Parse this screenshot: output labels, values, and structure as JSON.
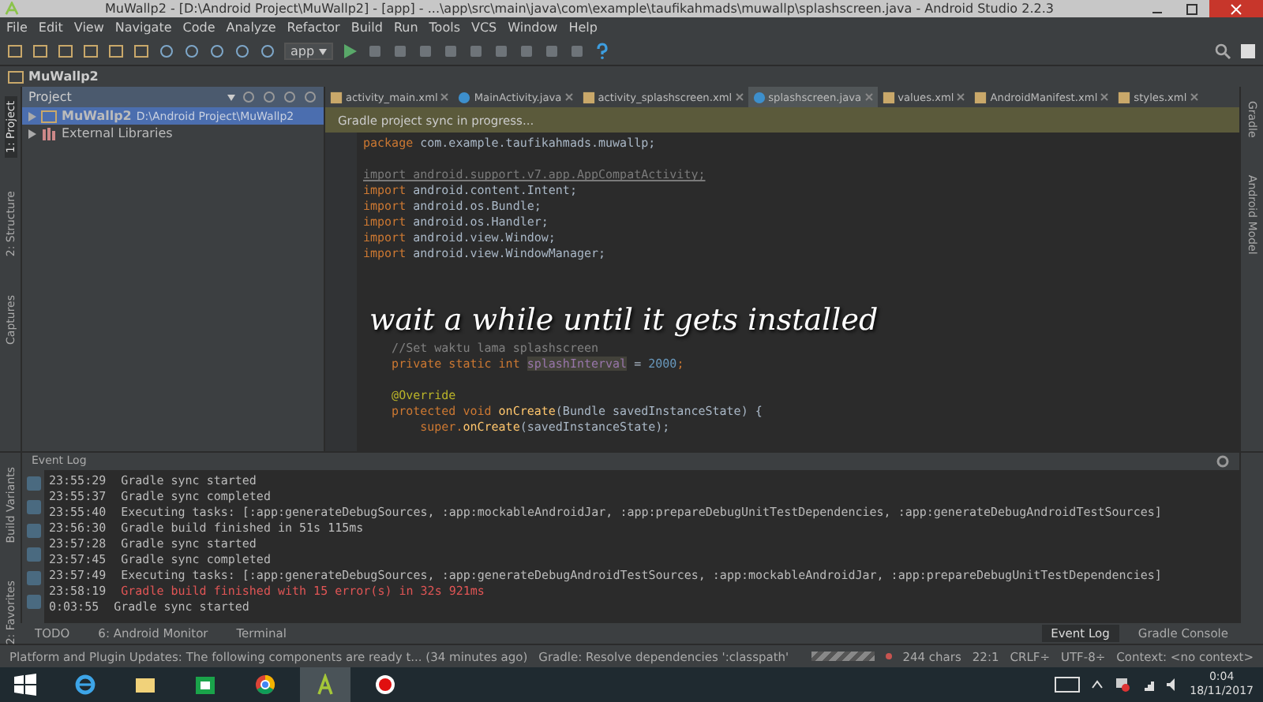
{
  "window": {
    "title": "MuWallp2 - [D:\\Android Project\\MuWallp2] - [app] - ...\\app\\src\\main\\java\\com\\example\\taufikahmads\\muwallp\\splashscreen.java - Android Studio 2.2.3"
  },
  "menu": [
    "File",
    "Edit",
    "View",
    "Navigate",
    "Code",
    "Analyze",
    "Refactor",
    "Build",
    "Run",
    "Tools",
    "VCS",
    "Window",
    "Help"
  ],
  "toolbar": {
    "run_config": "app"
  },
  "breadcrumb": "MuWallp2",
  "left_stripe": [
    {
      "label": "1: Project",
      "selected": true
    },
    {
      "label": "2: Structure",
      "selected": false
    },
    {
      "label": "Captures",
      "selected": false
    }
  ],
  "project_panel": {
    "view": "Project",
    "tree": [
      {
        "label": "MuWallp2",
        "path": "D:\\Android Project\\MuWallp2",
        "kind": "module",
        "selected": true
      },
      {
        "label": "External Libraries",
        "kind": "library",
        "selected": false
      }
    ]
  },
  "editor_tabs": [
    {
      "label": "activity_main.xml",
      "kind": "xml",
      "selected": false
    },
    {
      "label": "MainActivity.java",
      "kind": "class",
      "selected": false
    },
    {
      "label": "activity_splashscreen.xml",
      "kind": "xml",
      "selected": false
    },
    {
      "label": "splashscreen.java",
      "kind": "class",
      "selected": true
    },
    {
      "label": "values.xml",
      "kind": "xml",
      "selected": false
    },
    {
      "label": "AndroidManifest.xml",
      "kind": "xml",
      "selected": false
    },
    {
      "label": "styles.xml",
      "kind": "xml",
      "selected": false
    }
  ],
  "notification": "Gradle project sync in progress...",
  "code_blocks": [
    {
      "lines": [
        [
          {
            "text": "package ",
            "kind": "keyword"
          },
          {
            "text": "com.example.taufikahmads.muwallp;",
            "kind": "plain"
          }
        ]
      ]
    },
    {
      "lines": [
        [
          {
            "text": "import android.support.v7.app.AppCompatActivity;",
            "kind": "unused"
          }
        ],
        [
          {
            "text": "import ",
            "kind": "keyword"
          },
          {
            "text": "android.content.Intent;",
            "kind": "plain"
          }
        ],
        [
          {
            "text": "import ",
            "kind": "keyword"
          },
          {
            "text": "android.os.Bundle;",
            "kind": "plain"
          }
        ],
        [
          {
            "text": "import ",
            "kind": "keyword"
          },
          {
            "text": "android.os.Handler;",
            "kind": "plain"
          }
        ],
        [
          {
            "text": "import ",
            "kind": "keyword"
          },
          {
            "text": "android.view.Window;",
            "kind": "plain"
          }
        ],
        [
          {
            "text": "import ",
            "kind": "keyword"
          },
          {
            "text": "android.view.WindowManager;",
            "kind": "plain"
          }
        ]
      ]
    },
    {
      "lines": [
        [
          {
            "text": "    //Set waktu lama splashscreen",
            "kind": "comment"
          }
        ],
        [
          {
            "text": "    private static int ",
            "kind": "keyword"
          },
          {
            "text": "splashInterval",
            "kind": "field"
          },
          {
            "text": " = ",
            "kind": "plain"
          },
          {
            "text": "2000",
            "kind": "number"
          },
          {
            "text": ";",
            "kind": "keyword"
          }
        ]
      ]
    },
    {
      "lines": [
        [
          {
            "text": "    @Override",
            "kind": "annotation"
          }
        ],
        [
          {
            "text": "    protected void ",
            "kind": "keyword"
          },
          {
            "text": "onCreate",
            "kind": "method"
          },
          {
            "text": "(Bundle savedInstanceState) {",
            "kind": "plain"
          }
        ],
        [
          {
            "text": "        super.",
            "kind": "keyword"
          },
          {
            "text": "onCreate",
            "kind": "method"
          },
          {
            "text": "(savedInstanceState);",
            "kind": "plain"
          }
        ]
      ]
    }
  ],
  "caption": "wait a while until it gets installed",
  "right_stripe": [
    {
      "label": "Gradle"
    },
    {
      "label": "Android Model"
    }
  ],
  "event_log": {
    "title": "Event Log",
    "side_tabs": [
      {
        "label": "Build Variants"
      },
      {
        "label": "2: Favorites"
      }
    ],
    "entries": [
      {
        "time": "23:55:29",
        "message": "Gradle sync started",
        "kind": "info"
      },
      {
        "time": "23:55:37",
        "message": "Gradle sync completed",
        "kind": "info"
      },
      {
        "time": "23:55:40",
        "message": "Executing tasks: [:app:generateDebugSources, :app:mockableAndroidJar, :app:prepareDebugUnitTestDependencies, :app:generateDebugAndroidTestSources]",
        "kind": "info"
      },
      {
        "time": "23:56:30",
        "message": "Gradle build finished in 51s 115ms",
        "kind": "info"
      },
      {
        "time": "23:57:28",
        "message": "Gradle sync started",
        "kind": "info"
      },
      {
        "time": "23:57:45",
        "message": "Gradle sync completed",
        "kind": "info"
      },
      {
        "time": "23:57:49",
        "message": "Executing tasks: [:app:generateDebugSources, :app:generateDebugAndroidTestSources, :app:mockableAndroidJar, :app:prepareDebugUnitTestDependencies]",
        "kind": "info"
      },
      {
        "time": "23:58:19",
        "message": "Gradle build finished with 15 error(s) in 32s 921ms",
        "kind": "error"
      },
      {
        "time": "0:03:55",
        "message": "Gradle sync started",
        "kind": "info"
      }
    ]
  },
  "tool_tabs_left": [
    {
      "label": "TODO",
      "selected": false
    },
    {
      "label": "6: Android Monitor",
      "selected": false
    },
    {
      "label": "Terminal",
      "selected": false
    }
  ],
  "tool_tabs_right": [
    {
      "label": "Event Log",
      "selected": true
    },
    {
      "label": "Gradle Console",
      "selected": false
    }
  ],
  "status_bar": {
    "message": "Platform and Plugin Updates: The following components are ready t... (34 minutes ago)",
    "task": "Gradle: Resolve dependencies ':classpath'",
    "chars": "244 chars",
    "position": "22:1",
    "line_sep": "CRLF÷",
    "encoding": "UTF-8÷",
    "context": "Context: <no context>",
    "progress": {
      "level": 1
    }
  },
  "taskbar": {
    "apps": [
      {
        "kind": "browser-e",
        "selected": false
      },
      {
        "kind": "folder",
        "selected": false
      },
      {
        "kind": "store",
        "selected": false
      },
      {
        "kind": "chrome",
        "selected": false
      },
      {
        "kind": "android",
        "selected": true
      },
      {
        "kind": "record",
        "selected": false
      }
    ],
    "time": "0:04",
    "date": "18/11/2017"
  }
}
